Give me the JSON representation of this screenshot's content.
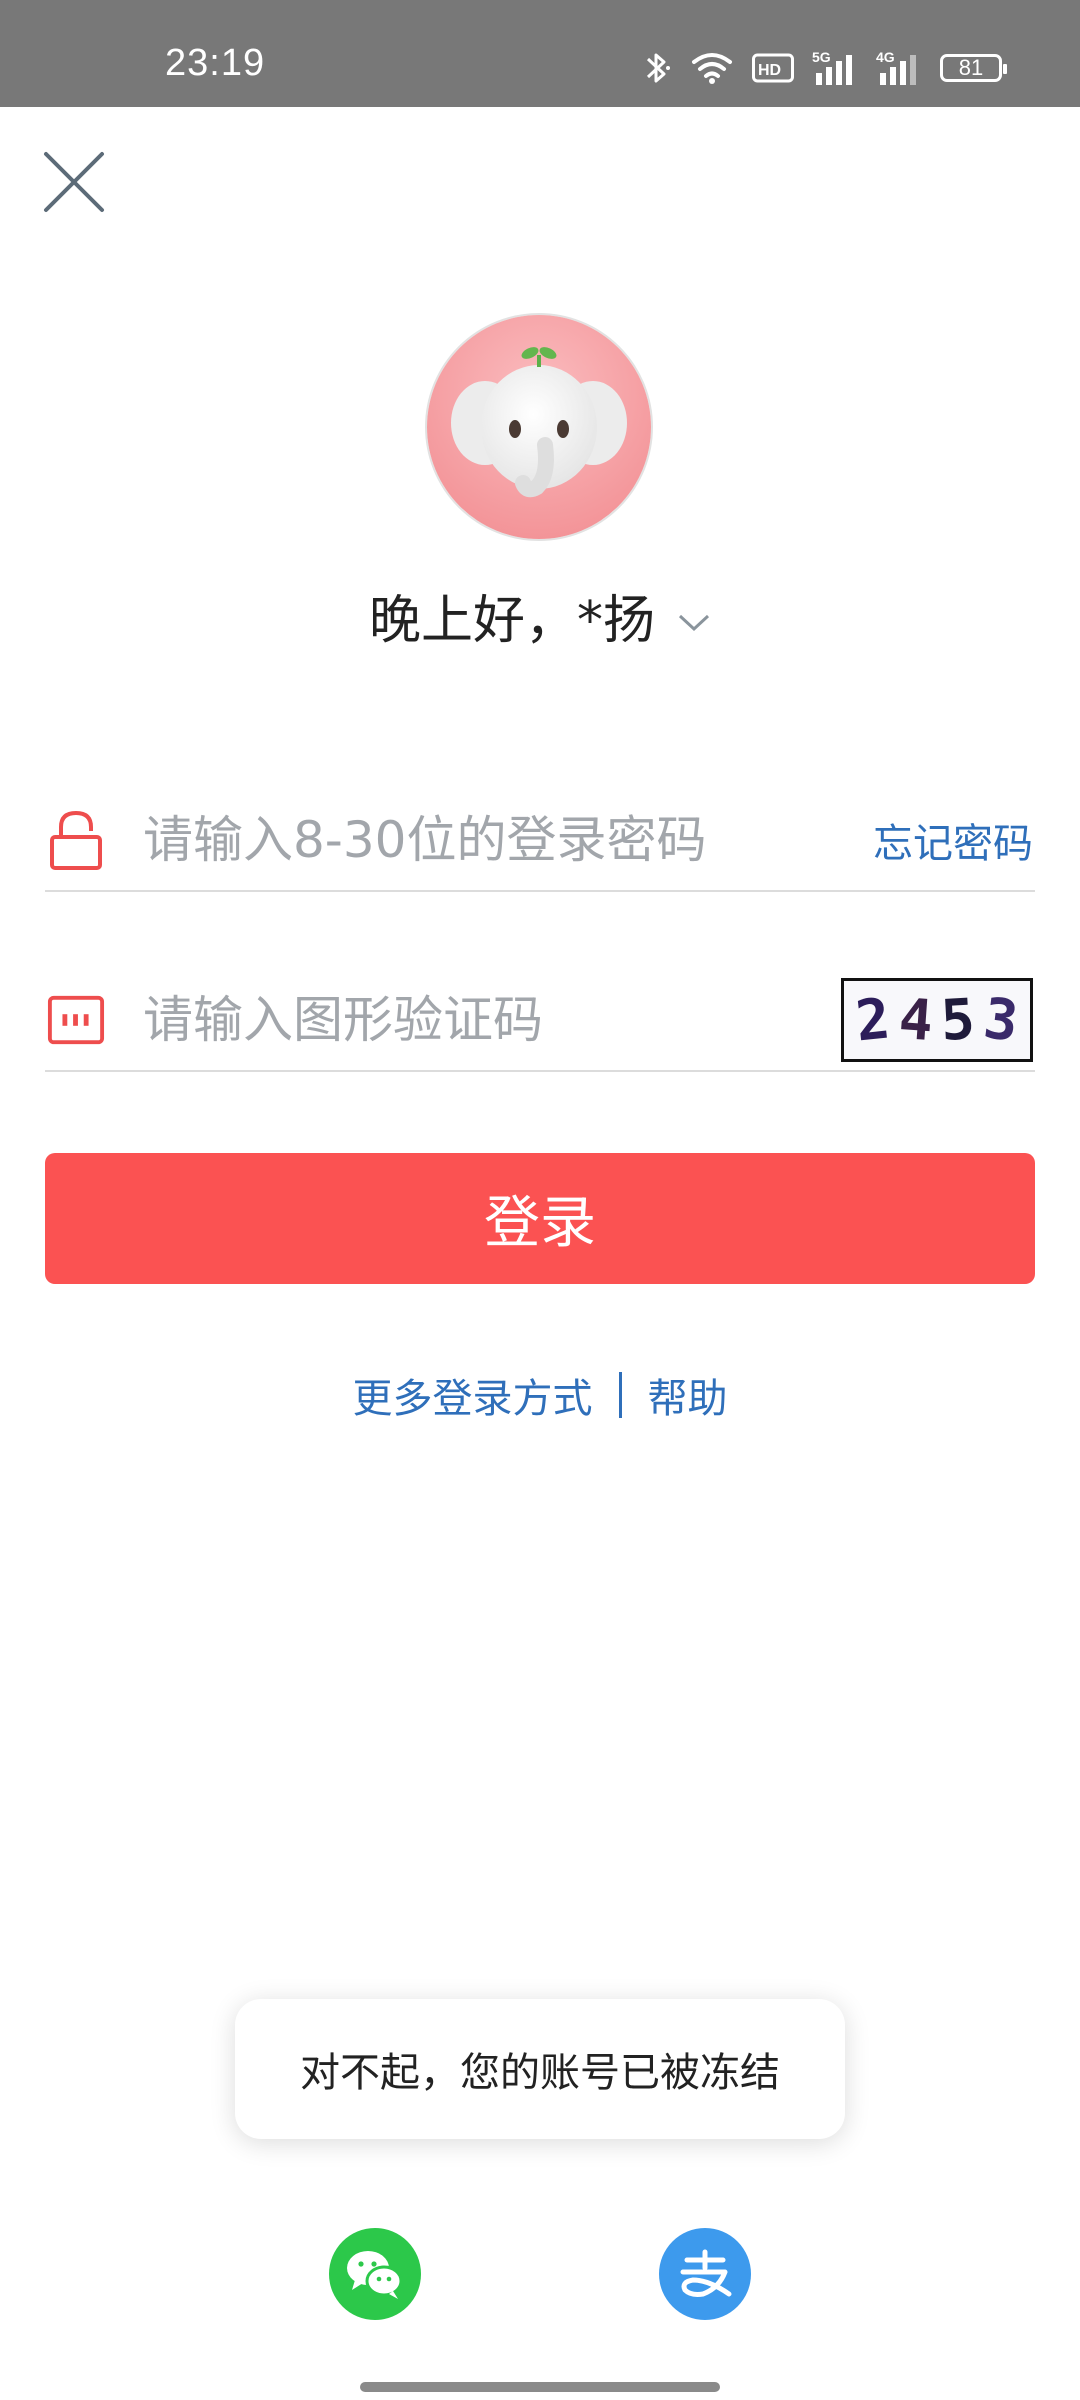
{
  "status_bar": {
    "time": "23:19",
    "hd_label": "HD",
    "signal1_label": "5G",
    "signal2_label": "4G",
    "battery_level": "81"
  },
  "avatar": {
    "icon": "elephant-mascot-icon",
    "background": "#f6a3a6"
  },
  "greeting": "晚上好，*扬",
  "password_field": {
    "placeholder": "请输入8-30位的登录密码",
    "value": "",
    "forgot_label": "忘记密码"
  },
  "captcha_field": {
    "placeholder": "请输入图形验证码",
    "value": "",
    "captcha_chars": [
      "2",
      "4",
      "5",
      "3"
    ]
  },
  "login_button": {
    "label": "登录",
    "color": "#fb5252"
  },
  "links": {
    "more_login": "更多登录方式",
    "help": "帮助",
    "color": "#2f6fba"
  },
  "toast": {
    "message": "对不起，您的账号已被冻结"
  },
  "social": {
    "wechat": {
      "icon": "wechat-icon",
      "color": "#2cc84a"
    },
    "alipay": {
      "icon": "alipay-icon",
      "color": "#3d9aed"
    }
  }
}
